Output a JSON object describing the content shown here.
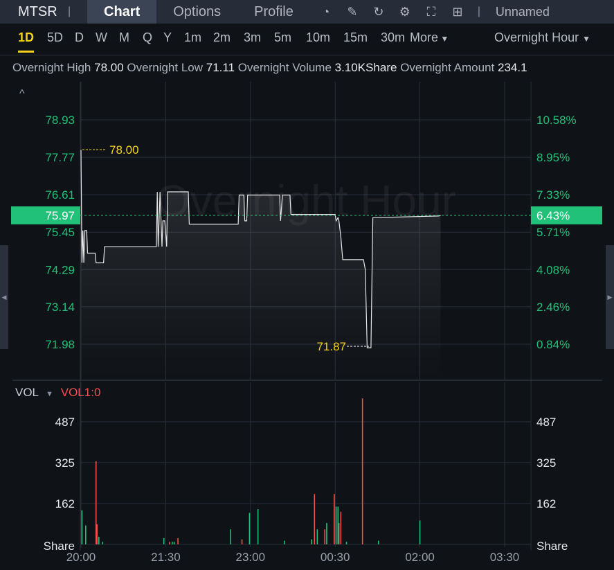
{
  "header": {
    "symbol": "MTSR",
    "tabs": [
      "Chart",
      "Options",
      "Profile"
    ],
    "active_tab": "Chart",
    "layout_name": "Unnamed",
    "icons": [
      "indicator-icon",
      "draw-icon",
      "refresh-icon",
      "settings-icon",
      "fullscreen-icon",
      "layout-grid-icon"
    ]
  },
  "timeframes": [
    "1D",
    "5D",
    "D",
    "W",
    "M",
    "Q",
    "Y",
    "1m",
    "2m",
    "3m",
    "5m",
    "10m",
    "15m",
    "30m"
  ],
  "active_timeframe": "1D",
  "more_label": "More",
  "session_label": "Overnight Hour",
  "info": {
    "high_label": "Overnight High",
    "high": "78.00",
    "low_label": "Overnight Low",
    "low": "71.11",
    "volume_label": "Overnight Volume",
    "volume": "3.10KShare",
    "amount_label": "Overnight Amount",
    "amount": "234.1"
  },
  "watermark": "Overnight Hour",
  "colors": {
    "up": "#22c17a",
    "down": "#f0524f",
    "highlight": "#f4d21c"
  },
  "chart_data": [
    {
      "type": "line",
      "title": "Price",
      "x_unit": "minutes since 20:00",
      "x_ticks": [
        "20:00",
        "21:30",
        "23:00",
        "00:30",
        "02:00",
        "03:30"
      ],
      "y_ticks": [
        "78.93",
        "77.77",
        "76.61",
        "75.45",
        "74.29",
        "73.14",
        "71.98"
      ],
      "y_ticks_right": [
        "10.58%",
        "8.95%",
        "7.33%",
        "5.71%",
        "4.08%",
        "2.46%",
        "0.84%"
      ],
      "ylim": [
        71.98,
        78.93
      ],
      "current_price": "75.97",
      "current_pct": "6.43%",
      "high_annotation": "78.00",
      "low_annotation": "71.87",
      "points": [
        [
          0,
          78.0
        ],
        [
          1,
          74.5
        ],
        [
          2,
          75.5
        ],
        [
          3,
          74.5
        ],
        [
          4,
          75.5
        ],
        [
          6,
          75.5
        ],
        [
          7,
          74.8
        ],
        [
          15,
          74.8
        ],
        [
          16,
          74.5
        ],
        [
          24,
          74.5
        ],
        [
          25,
          75.0
        ],
        [
          80,
          75.0
        ],
        [
          81,
          76.7
        ],
        [
          82,
          75.0
        ],
        [
          84,
          76.7
        ],
        [
          86,
          75.0
        ],
        [
          87,
          75.8
        ],
        [
          89,
          75.8
        ],
        [
          91,
          75.0
        ],
        [
          92,
          76.7
        ],
        [
          114,
          76.7
        ],
        [
          115,
          75.7
        ],
        [
          167,
          75.7
        ],
        [
          168,
          76.6
        ],
        [
          173,
          76.6
        ],
        [
          174,
          75.8
        ],
        [
          176,
          75.8
        ],
        [
          177,
          76.6
        ],
        [
          211,
          76.6
        ],
        [
          212,
          75.8
        ],
        [
          214,
          76.6
        ],
        [
          222,
          76.6
        ],
        [
          223,
          76.0
        ],
        [
          270,
          76.0
        ],
        [
          271,
          75.8
        ],
        [
          273,
          75.9
        ],
        [
          274,
          75.8
        ],
        [
          276,
          75.3
        ],
        [
          278,
          74.6
        ],
        [
          300,
          74.6
        ],
        [
          302,
          74.3
        ],
        [
          304,
          71.87
        ],
        [
          308,
          71.87
        ],
        [
          310,
          75.9
        ],
        [
          380,
          75.95
        ],
        [
          382,
          75.97
        ]
      ]
    },
    {
      "type": "bar",
      "title": "VOL",
      "indicator_label": "VOL1:0",
      "unit": "Share",
      "y_ticks": [
        "487",
        "325",
        "162"
      ],
      "ylim": [
        0,
        487
      ],
      "bars": [
        [
          1,
          135,
          "up"
        ],
        [
          5,
          75,
          "up"
        ],
        [
          16,
          330,
          "down"
        ],
        [
          17,
          80,
          "down"
        ],
        [
          19,
          30,
          "up"
        ],
        [
          23,
          10,
          "up"
        ],
        [
          88,
          25,
          "up"
        ],
        [
          94,
          10,
          "down"
        ],
        [
          97,
          10,
          "up"
        ],
        [
          99,
          10,
          "up"
        ],
        [
          103,
          25,
          "down"
        ],
        [
          159,
          60,
          "up"
        ],
        [
          171,
          20,
          "down"
        ],
        [
          179,
          125,
          "up"
        ],
        [
          188,
          140,
          "up"
        ],
        [
          216,
          15,
          "up"
        ],
        [
          245,
          20,
          "up"
        ],
        [
          248,
          200,
          "down"
        ],
        [
          251,
          60,
          "up"
        ],
        [
          259,
          60,
          "down"
        ],
        [
          261,
          85,
          "up"
        ],
        [
          269,
          200,
          "down"
        ],
        [
          271,
          150,
          "up"
        ],
        [
          273,
          150,
          "up"
        ],
        [
          274,
          85,
          "down"
        ],
        [
          276,
          130,
          "down"
        ],
        [
          282,
          10,
          "up"
        ],
        [
          299,
          580,
          "down"
        ],
        [
          316,
          15,
          "up"
        ],
        [
          360,
          95,
          "up"
        ]
      ]
    }
  ]
}
